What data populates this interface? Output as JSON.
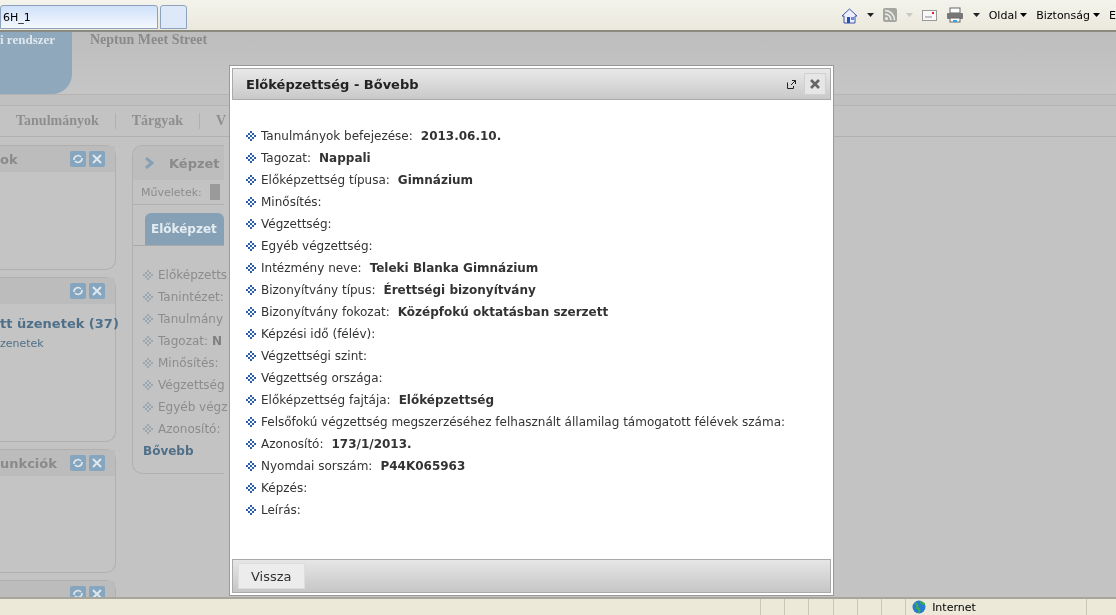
{
  "browser": {
    "tabs": [
      {
        "label": "6H_1",
        "selected": true
      }
    ],
    "menus": [
      "Oldal",
      "Biztonság",
      "E"
    ]
  },
  "page": {
    "logo_text": "i rendszer",
    "site_subtitle": "Neptun Meet Street",
    "nav": [
      "Tanulmányok",
      "Tárgyak",
      "V"
    ],
    "side_panels": [
      {
        "kind": "widget",
        "title": "ok"
      },
      {
        "kind": "widget",
        "items": [
          {
            "text": "tt üzenetek (37)",
            "kind": "strong"
          },
          {
            "text": "zenetek",
            "kind": "plain"
          }
        ]
      },
      {
        "kind": "widget",
        "title": "unkciók"
      },
      {
        "kind": "widget"
      }
    ],
    "main_panel": {
      "title": "Képzet",
      "actions_label": "Műveletek:",
      "tab": "Előképzet",
      "fields": [
        "Előképzetts",
        "Tanintézet:",
        "Tanulmány",
        "Tagozat: **N**",
        "Minősítés:",
        "Végzettség",
        "Egyéb végz",
        "Azonosító:"
      ],
      "more_link": "Bővebb"
    }
  },
  "dialog": {
    "title": "Előképzettség - Bővebb",
    "rows": [
      {
        "label": "Tanulmányok befejezése:",
        "value": "2013.06.10."
      },
      {
        "label": "Tagozat:",
        "value": "Nappali"
      },
      {
        "label": "Előképzettség típusa:",
        "value": "Gimnázium"
      },
      {
        "label": "Minősítés:"
      },
      {
        "label": "Végzettség:"
      },
      {
        "label": "Egyéb végzettség:"
      },
      {
        "label": "Intézmény neve:",
        "value": "Teleki Blanka Gimnázium"
      },
      {
        "label": "Bizonyítvány típus:",
        "value": "Érettségi bizonyítvány"
      },
      {
        "label": "Bizonyítvány fokozat:",
        "value": "Középfokú oktatásban szerzett"
      },
      {
        "label": "Képzési idő (félév):"
      },
      {
        "label": "Végzettségi szint:"
      },
      {
        "label": "Végzettség országa:"
      },
      {
        "label": "Előképzettség fajtája:",
        "value": "Előképzettség"
      },
      {
        "label": "Felsőfokú végzettség megszerzéséhez felhasznált államilag támogatott félévek száma:"
      },
      {
        "label": "Azonosító:",
        "value": "173/1/2013."
      },
      {
        "label": "Nyomdai sorszám:",
        "value": "P44K065963"
      },
      {
        "label": "Képzés:"
      },
      {
        "label": "Leírás:"
      }
    ],
    "button": "Vissza"
  },
  "status_bar": {
    "zone": "Internet"
  }
}
